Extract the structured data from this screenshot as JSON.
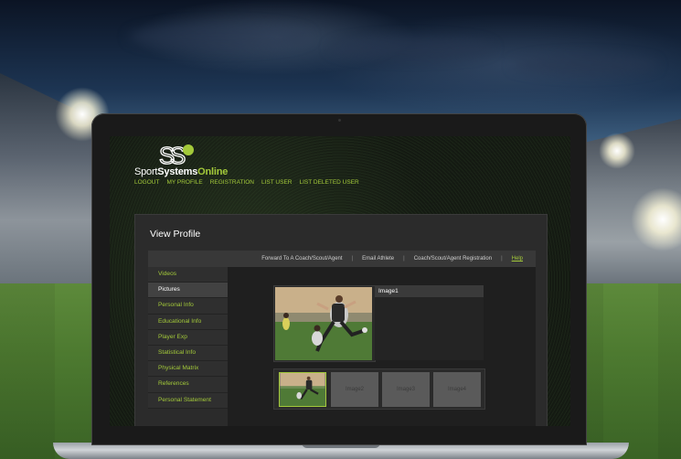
{
  "brand": {
    "logo_mark": "SS",
    "name_part1": "Sport",
    "name_part2": "Systems",
    "name_part3": "Online",
    "accent_color": "#a3c93a"
  },
  "topnav": [
    "LOGOUT",
    "MY PROFILE",
    "REGISTRATION",
    "LIST USER",
    "LIST DELETED USER"
  ],
  "page": {
    "title": "View Profile"
  },
  "toolbar": {
    "links": [
      "Forward To A Coach/Scout/Agent",
      "Email Athlete",
      "Coach/Scout/Agent Registration"
    ],
    "separator": "|",
    "help": "Help"
  },
  "sidebar": {
    "items": [
      {
        "label": "Videos",
        "active": false
      },
      {
        "label": "Pictures",
        "active": true
      },
      {
        "label": "Personal Info",
        "active": false
      },
      {
        "label": "Educational Info",
        "active": false
      },
      {
        "label": "Player Exp",
        "active": false
      },
      {
        "label": "Statistical Info",
        "active": false
      },
      {
        "label": "Physical Matrix",
        "active": false
      },
      {
        "label": "References",
        "active": false
      },
      {
        "label": "Personal Statement",
        "active": false
      }
    ]
  },
  "gallery": {
    "main_caption": "Image1",
    "thumbs": [
      "",
      "Image2",
      "Image3",
      "Image4"
    ],
    "selected_index": 0
  }
}
